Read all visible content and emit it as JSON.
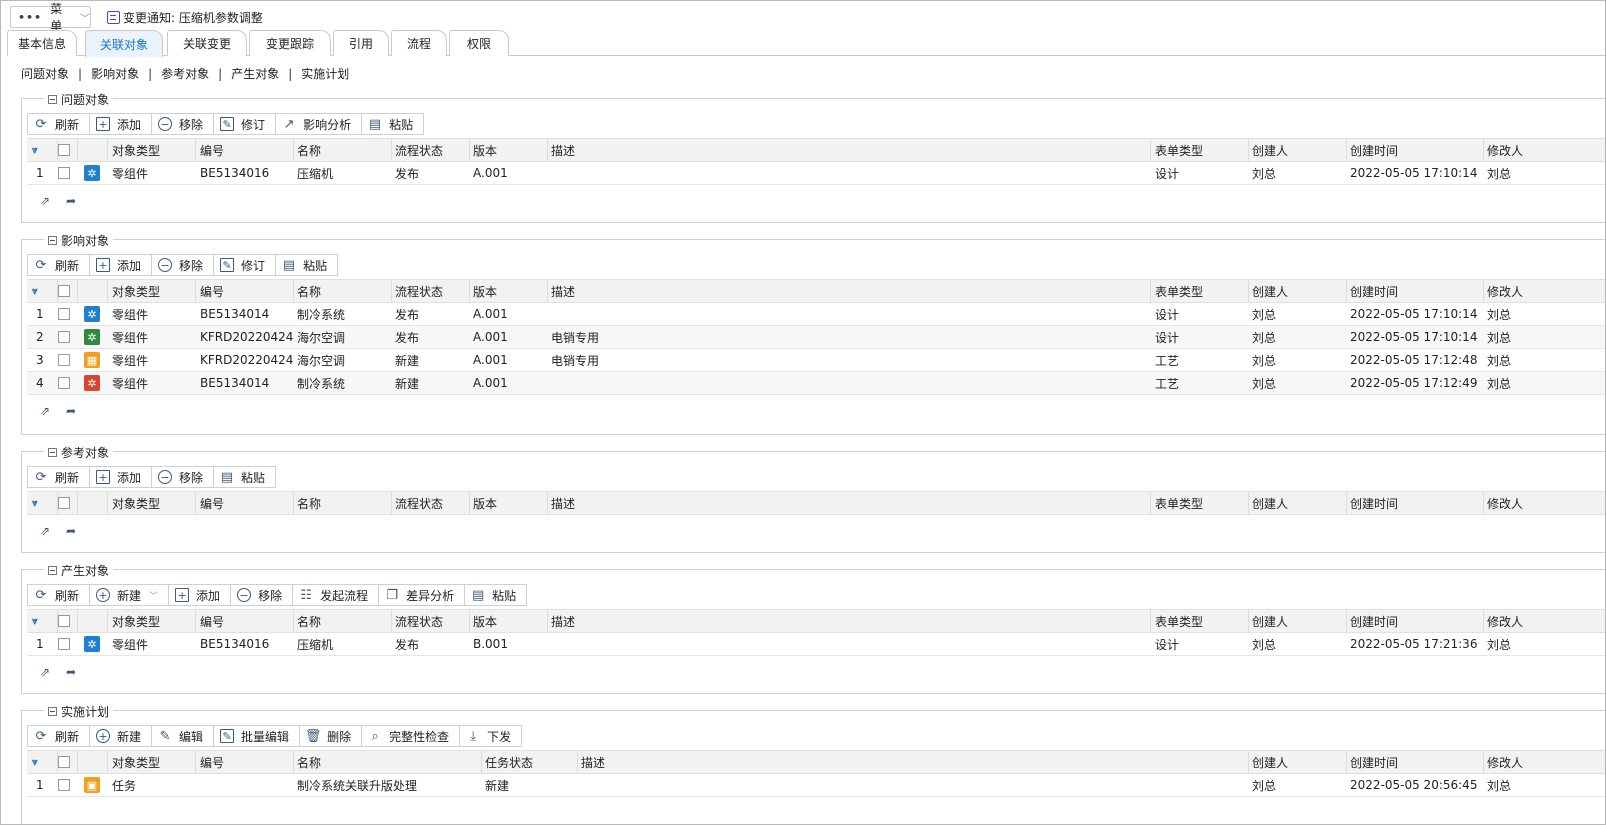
{
  "menu": {
    "label": "菜单"
  },
  "document": {
    "title": "变更通知: 压缩机参数调整"
  },
  "tabs": [
    {
      "label": "基本信息",
      "active": false
    },
    {
      "label": "关联对象",
      "active": true
    },
    {
      "label": "关联变更",
      "active": false
    },
    {
      "label": "变更跟踪",
      "active": false
    },
    {
      "label": "引用",
      "active": false
    },
    {
      "label": "流程",
      "active": false
    },
    {
      "label": "权限",
      "active": false
    }
  ],
  "subnav": [
    "问题对象",
    "影响对象",
    "参考对象",
    "产生对象",
    "实施计划"
  ],
  "sections": {
    "problem": {
      "title": "问题对象",
      "toolbar": [
        "刷新",
        "添加",
        "移除",
        "修订",
        "影响分析",
        "粘贴"
      ],
      "rows": [
        {
          "no": "1",
          "icon": "part-icon-blue",
          "type": "零组件",
          "code": "BE5134016",
          "name": "压缩机",
          "status": "发布",
          "version": "A.001",
          "desc": "",
          "formtype": "设计",
          "creator": "刘总",
          "created": "2022-05-05 17:10:14",
          "modifier": "刘总"
        }
      ]
    },
    "impact": {
      "title": "影响对象",
      "toolbar": [
        "刷新",
        "添加",
        "移除",
        "修订",
        "粘贴"
      ],
      "rows": [
        {
          "no": "1",
          "icon": "part-icon-blue",
          "type": "零组件",
          "code": "BE5134014",
          "name": "制冷系统",
          "status": "发布",
          "version": "A.001",
          "desc": "",
          "formtype": "设计",
          "creator": "刘总",
          "created": "2022-05-05 17:10:14",
          "modifier": "刘总"
        },
        {
          "no": "2",
          "icon": "part-icon-green",
          "type": "零组件",
          "code": "KFRD20220424",
          "name": "海尔空调",
          "status": "发布",
          "version": "A.001",
          "desc": "电销专用",
          "formtype": "设计",
          "creator": "刘总",
          "created": "2022-05-05 17:10:14",
          "modifier": "刘总"
        },
        {
          "no": "3",
          "icon": "part-icon-orange",
          "type": "零组件",
          "code": "KFRD20220424",
          "name": "海尔空调",
          "status": "新建",
          "version": "A.001",
          "desc": "电销专用",
          "formtype": "工艺",
          "creator": "刘总",
          "created": "2022-05-05 17:12:48",
          "modifier": "刘总"
        },
        {
          "no": "4",
          "icon": "part-icon-red",
          "type": "零组件",
          "code": "BE5134014",
          "name": "制冷系统",
          "status": "新建",
          "version": "A.001",
          "desc": "",
          "formtype": "工艺",
          "creator": "刘总",
          "created": "2022-05-05 17:12:49",
          "modifier": "刘总"
        }
      ]
    },
    "reference": {
      "title": "参考对象",
      "toolbar": [
        "刷新",
        "添加",
        "移除",
        "粘贴"
      ],
      "rows": []
    },
    "produced": {
      "title": "产生对象",
      "toolbar": [
        "刷新",
        "新建",
        "添加",
        "移除",
        "发起流程",
        "差异分析",
        "粘贴"
      ],
      "rows": [
        {
          "no": "1",
          "icon": "part-icon-blue",
          "type": "零组件",
          "code": "BE5134016",
          "name": "压缩机",
          "status": "发布",
          "version": "B.001",
          "desc": "",
          "formtype": "设计",
          "creator": "刘总",
          "created": "2022-05-05 17:21:36",
          "modifier": "刘总"
        }
      ]
    },
    "plan": {
      "title": "实施计划",
      "toolbar": [
        "刷新",
        "新建",
        "编辑",
        "批量编辑",
        "删除",
        "完整性检查",
        "下发"
      ],
      "rows": [
        {
          "no": "1",
          "icon": "task-icon-orange",
          "type": "任务",
          "code": "",
          "name": "制冷系统关联升版处理",
          "status": "新建",
          "desc": "",
          "creator": "刘总",
          "created": "2022-05-05 20:56:45",
          "modifier": "刘总"
        }
      ]
    }
  },
  "columns": {
    "object": [
      "对象类型",
      "编号",
      "名称",
      "流程状态",
      "版本",
      "描述",
      "表单类型",
      "创建人",
      "创建时间",
      "修改人"
    ],
    "plan": [
      "对象类型",
      "编号",
      "名称",
      "任务状态",
      "描述",
      "创建人",
      "创建时间",
      "修改人"
    ]
  },
  "colors": {
    "accent": "#1a73c8",
    "blue_icon": "#1f7fd0",
    "green_icon": "#2e8b3e",
    "orange_icon": "#f0a020",
    "red_icon": "#d9462f"
  }
}
